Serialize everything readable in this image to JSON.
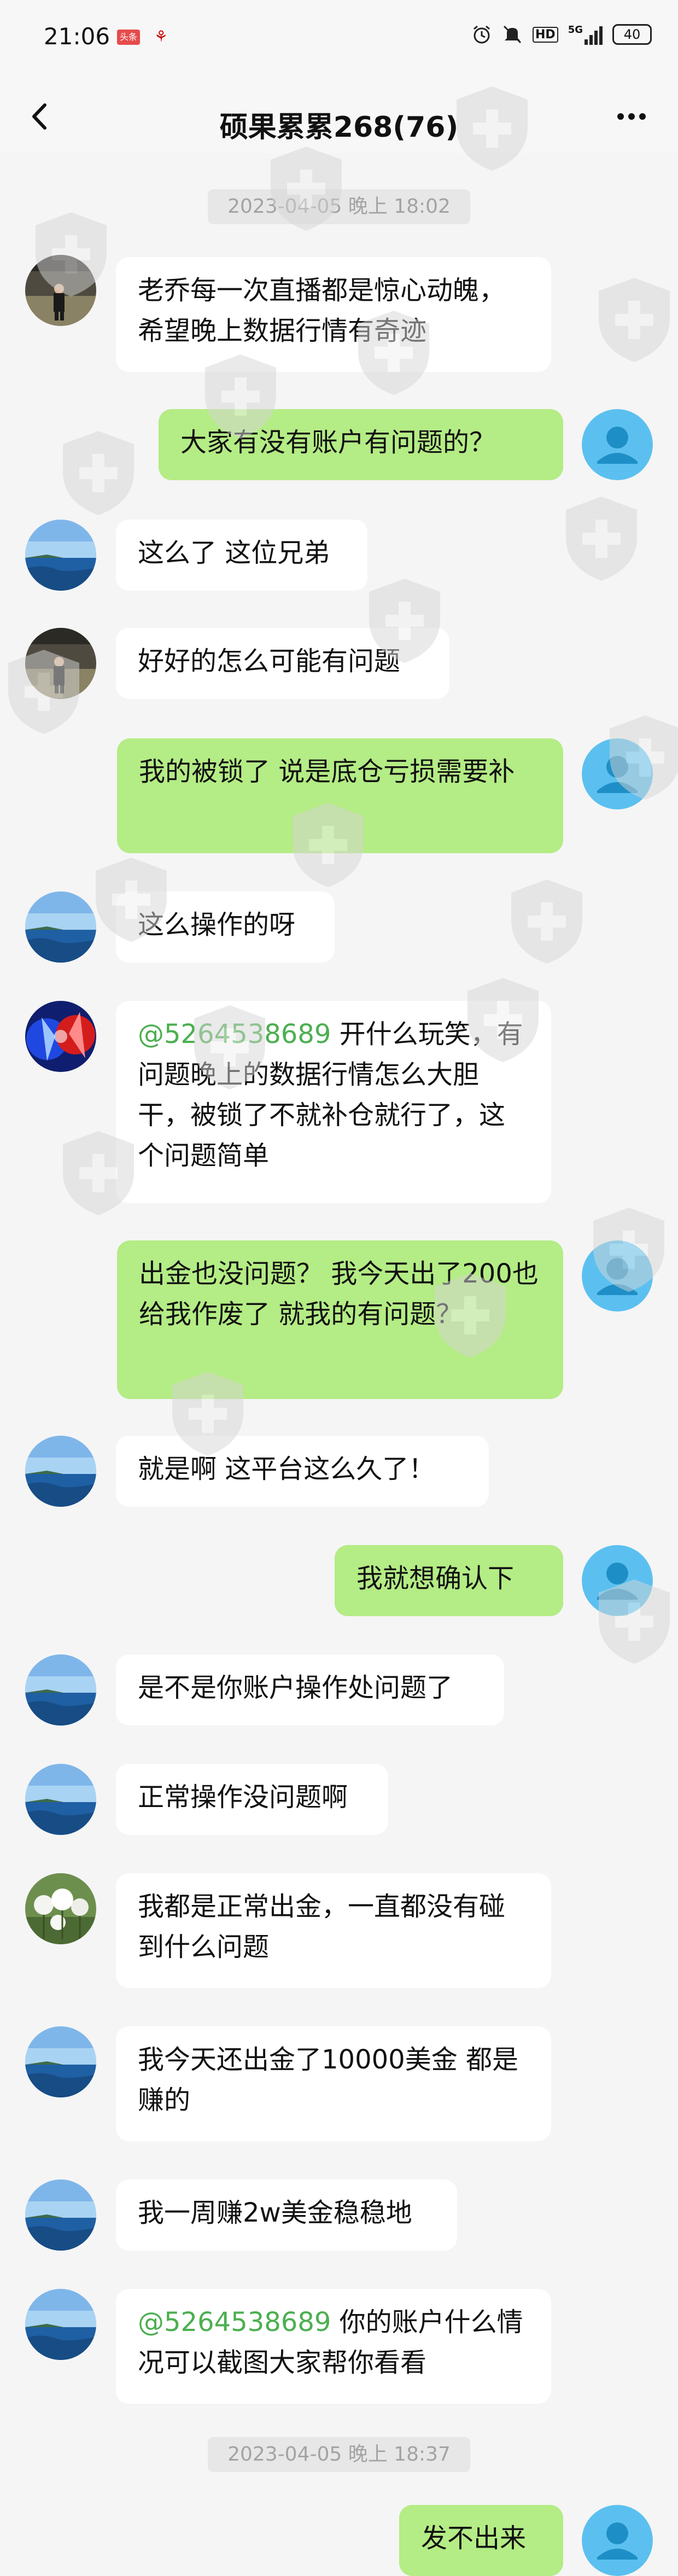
{
  "status_bar": {
    "time": "21:06",
    "badge": "头条",
    "network": "5G",
    "battery": "40",
    "hd": "HD"
  },
  "header": {
    "title": "硕果累累268(76)"
  },
  "timestamps": [
    "2023-04-05 晚上 18:02",
    "2023-04-05 晚上 18:37"
  ],
  "messages": [
    {
      "side": "in",
      "avatar": "man-avatar",
      "text": "老乔每一次直播都是惊心动魄，希望晚上数据行情有奇迹"
    },
    {
      "side": "out",
      "avatar": "self-avatar",
      "text": "大家有没有账户有问题的？"
    },
    {
      "side": "in",
      "avatar": "sea-avatar",
      "text": "这么了 这位兄弟"
    },
    {
      "side": "in",
      "avatar": "man-avatar",
      "text": "好好的怎么可能有问题"
    },
    {
      "side": "out",
      "avatar": "self-avatar",
      "text": "我的被锁了 说是底仓亏损需要补"
    },
    {
      "side": "in",
      "avatar": "sea-avatar",
      "text": "这么操作的呀"
    },
    {
      "side": "in",
      "avatar": "blue-red-avatar",
      "mention": "@5264538689",
      "text": " 开什么玩笑，有问题晚上的数据行情怎么大胆干，被锁了不就补仓就行了，这个问题简单"
    },
    {
      "side": "out",
      "avatar": "self-avatar",
      "text": "出金也没问题？ 我今天出了200也给我作废了 就我的有问题？"
    },
    {
      "side": "in",
      "avatar": "sea-avatar",
      "text": "就是啊 这平台这么久了！"
    },
    {
      "side": "out",
      "avatar": "self-avatar",
      "text": "我就想确认下"
    },
    {
      "side": "in",
      "avatar": "sea-avatar",
      "text": "是不是你账户操作处问题了"
    },
    {
      "side": "in",
      "avatar": "sea-avatar",
      "text": "正常操作没问题啊"
    },
    {
      "side": "in",
      "avatar": "dandelion-avatar",
      "text": "我都是正常出金，一直都没有碰到什么问题"
    },
    {
      "side": "in",
      "avatar": "sea-avatar",
      "text": "我今天还出金了10000美金 都是赚的"
    },
    {
      "side": "in",
      "avatar": "sea-avatar",
      "text": "我一周赚2w美金稳稳地"
    },
    {
      "side": "in",
      "avatar": "sea-avatar",
      "mention": "@5264538689",
      "text": " 你的账户什么情况可以截图大家帮你看看"
    },
    {
      "side": "out",
      "avatar": "self-avatar",
      "text": "发不出来"
    }
  ],
  "colors": {
    "background": "#f5f5f5",
    "incoming_bubble": "#ffffff",
    "outgoing_bubble": "#b4ec85",
    "mention": "#4caf50",
    "self_avatar": "#5bc0f0"
  },
  "icons": [
    "back-arrow-icon",
    "more-icon",
    "alarm-icon",
    "mute-icon",
    "signal-icon",
    "battery-icon",
    "watermark-shield-icon"
  ]
}
